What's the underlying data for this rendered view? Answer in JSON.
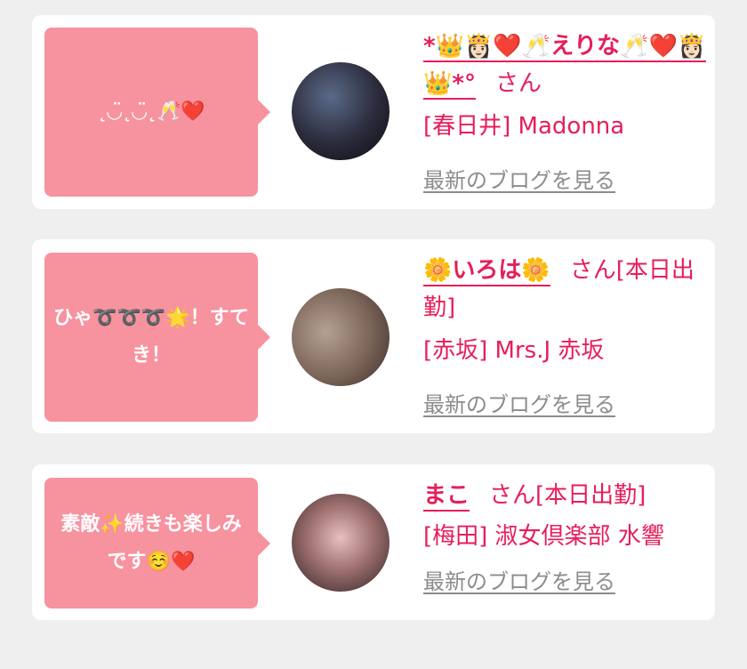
{
  "cards": [
    {
      "message": "˛◡̈˛◡̈˛🥂❤️",
      "name": "*👑👸🏻❤️🥂えりな🥂❤️👸🏻👑*°",
      "honorific": "さん",
      "shop": "[春日井] Madonna",
      "blog_link": "最新のブログを見る"
    },
    {
      "message": "ひゃ➰➰➰🌟！すてき！",
      "name": "🌼いろは🌼",
      "honorific": "さん[本日出勤]",
      "shop": "[赤坂] Mrs.J 赤坂",
      "blog_link": "最新のブログを見る"
    },
    {
      "message": "素敵✨続きも楽しみです☺️❤️",
      "name": "まこ",
      "honorific": "さん[本日出勤]",
      "shop": "[梅田] 淑女倶楽部 水響",
      "blog_link": "最新のブログを見る"
    }
  ]
}
